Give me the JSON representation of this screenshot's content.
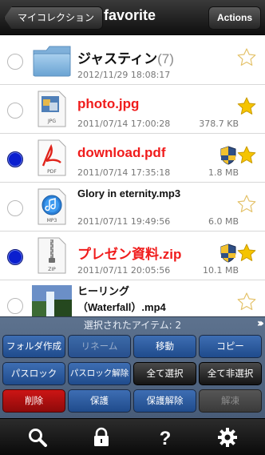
{
  "nav": {
    "back_label": "マイコレクション",
    "title": "favorite",
    "actions_label": "Actions"
  },
  "files": [
    {
      "name": "ジャスティン",
      "count": "(7)",
      "date": "2012/11/29 18:08:17",
      "size": "",
      "type": "folder",
      "selected": false,
      "highlighted": false,
      "starred": false,
      "locked": false
    },
    {
      "name": "photo.jpg",
      "count": "",
      "date": "2011/07/14 17:00:28",
      "size": "378.7 KB",
      "type": "jpg-icon",
      "selected": false,
      "highlighted": true,
      "starred": true,
      "locked": false
    },
    {
      "name": "download.pdf",
      "count": "",
      "date": "2011/07/14 17:35:18",
      "size": "1.8 MB",
      "type": "pdf-icon",
      "selected": true,
      "highlighted": true,
      "starred": true,
      "locked": true
    },
    {
      "name": "Glory in eternity.mp3",
      "count": "",
      "date": "2011/07/11 19:49:56",
      "size": "6.0 MB",
      "type": "mp3-icon",
      "selected": false,
      "highlighted": false,
      "starred": false,
      "locked": false
    },
    {
      "name": "プレゼン資料.zip",
      "count": "",
      "date": "2011/07/11 20:05:56",
      "size": "10.1 MB",
      "type": "zip-icon",
      "selected": true,
      "highlighted": true,
      "starred": true,
      "locked": true
    },
    {
      "name": "ヒーリング（Waterfall）.mp4",
      "count": "",
      "date": "",
      "size": "",
      "type": "video-thumbnail",
      "selected": false,
      "highlighted": false,
      "starred": false,
      "locked": false
    }
  ],
  "panel": {
    "title": "選択されたアイテム: 2",
    "buttons": {
      "folder": "フォルダ作成",
      "rename": "リネーム",
      "move": "移動",
      "copy": "コピー",
      "passlock": "パスロック",
      "passunlock": "パスロック解除",
      "select_all": "全て選択",
      "deselect_all": "全て非選択",
      "delete": "削除",
      "protect": "保護",
      "unprotect": "保護解除",
      "unzip": "解凍"
    }
  },
  "tabs": [
    "search-icon",
    "lock-icon",
    "help-icon",
    "settings-icon"
  ],
  "colors": {
    "highlight_red": "#f01c1c",
    "radio_selected": "#0b1fcf",
    "star_gold": "#f5c400",
    "panel_blue": "#2a5698",
    "delete_red": "#c41010"
  }
}
